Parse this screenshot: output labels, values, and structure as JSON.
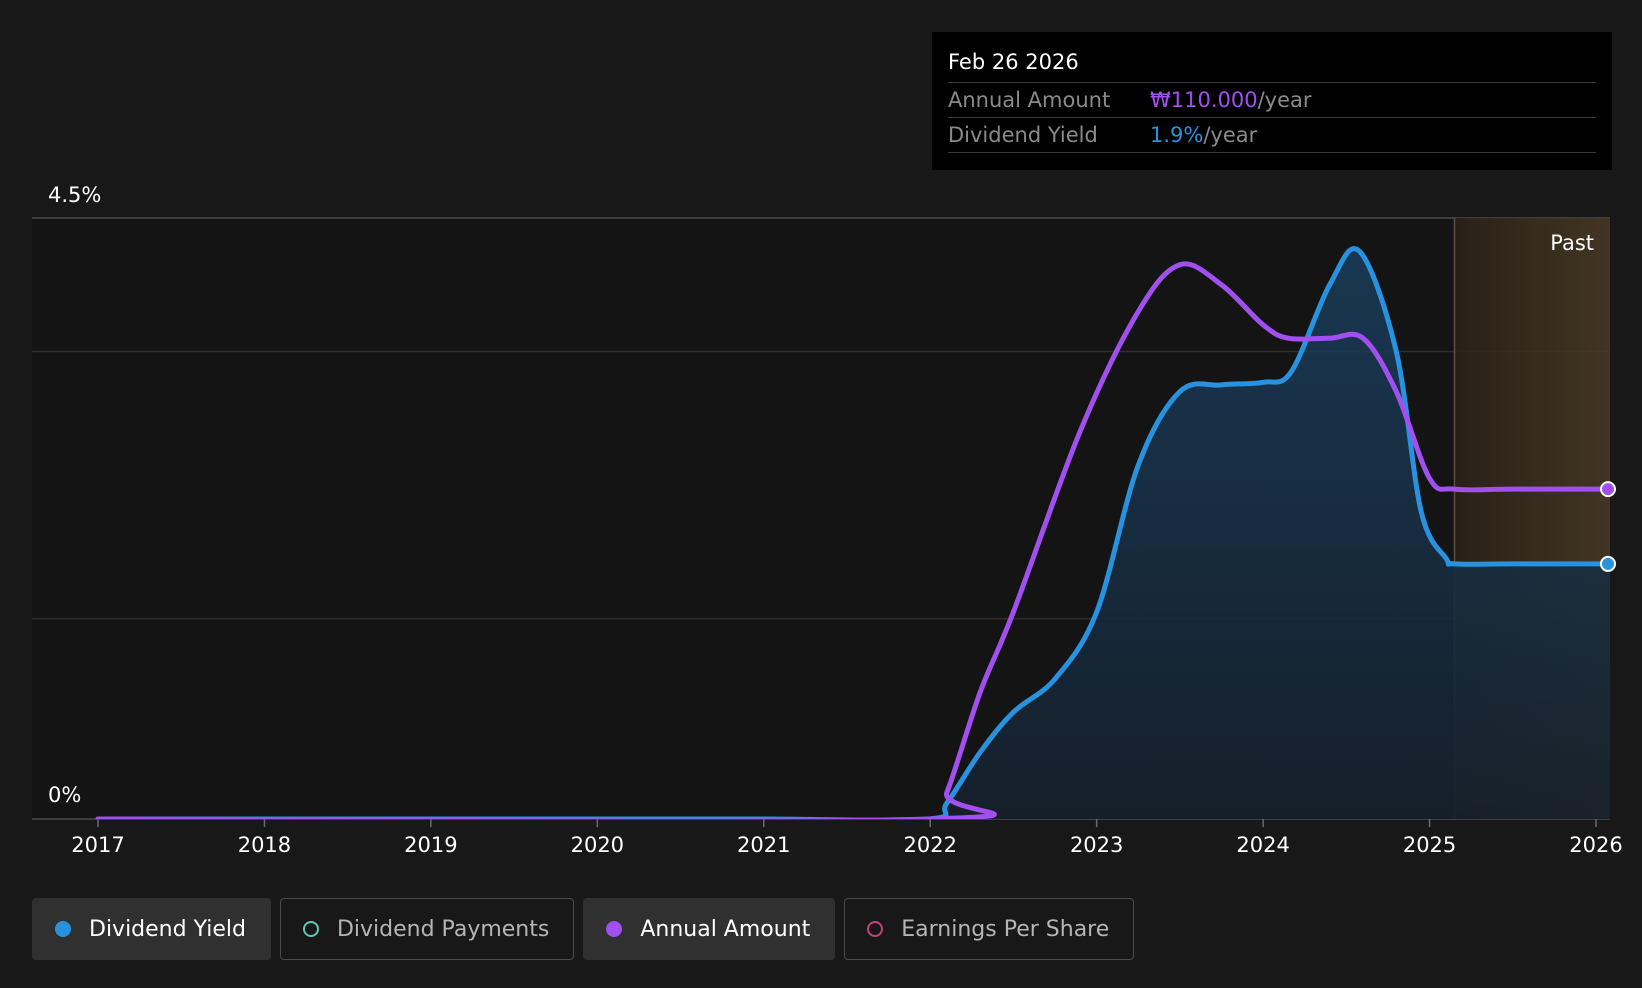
{
  "tooltip": {
    "date": "Feb 26 2026",
    "rows": [
      {
        "label": "Annual Amount",
        "value": "₩110.000",
        "unit": "/year",
        "color": "#a24ff0"
      },
      {
        "label": "Dividend Yield",
        "value": "1.9%",
        "unit": "/year",
        "color": "#2793e0"
      }
    ]
  },
  "legend": [
    {
      "label": "Dividend Yield",
      "color": "#2793e0",
      "active": true,
      "filled": true
    },
    {
      "label": "Dividend Payments",
      "color": "#5ec8b8",
      "active": false,
      "filled": false
    },
    {
      "label": "Annual Amount",
      "color": "#a24ff0",
      "active": true,
      "filled": true
    },
    {
      "label": "Earnings Per Share",
      "color": "#c2417e",
      "active": false,
      "filled": false
    }
  ],
  "chart_data": {
    "type": "line",
    "y_top_label": "4.5%",
    "y_bottom_label": "0%",
    "ylim": [
      0,
      4.5
    ],
    "xlim": [
      2017,
      2026.15
    ],
    "x_ticks": [
      "2017",
      "2018",
      "2019",
      "2020",
      "2021",
      "2022",
      "2023",
      "2024",
      "2025",
      "2026"
    ],
    "past_label": "Past",
    "past_start": 2025.15,
    "series": [
      {
        "name": "Dividend Yield",
        "color": "#2793e0",
        "area": true,
        "points": [
          [
            2017.0,
            0
          ],
          [
            2018.0,
            0
          ],
          [
            2019.0,
            0
          ],
          [
            2020.0,
            0
          ],
          [
            2021.0,
            0
          ],
          [
            2021.99,
            0
          ],
          [
            2022.1,
            0.12
          ],
          [
            2022.3,
            0.5
          ],
          [
            2022.5,
            0.8
          ],
          [
            2022.75,
            1.05
          ],
          [
            2023.0,
            1.55
          ],
          [
            2023.25,
            2.65
          ],
          [
            2023.5,
            3.2
          ],
          [
            2023.75,
            3.25
          ],
          [
            2024.0,
            3.27
          ],
          [
            2024.17,
            3.35
          ],
          [
            2024.4,
            4.0
          ],
          [
            2024.58,
            4.25
          ],
          [
            2024.8,
            3.5
          ],
          [
            2024.95,
            2.3
          ],
          [
            2025.1,
            1.95
          ],
          [
            2025.15,
            1.91
          ],
          [
            2025.5,
            1.91
          ],
          [
            2026.15,
            1.91
          ]
        ]
      },
      {
        "name": "Annual Amount",
        "color": "#a24ff0",
        "area": false,
        "points": [
          [
            2017.0,
            0
          ],
          [
            2021.99,
            0
          ],
          [
            2022.1,
            0.2
          ],
          [
            2022.3,
            0.95
          ],
          [
            2022.5,
            1.55
          ],
          [
            2022.9,
            2.9
          ],
          [
            2023.25,
            3.8
          ],
          [
            2023.5,
            4.15
          ],
          [
            2023.75,
            4.0
          ],
          [
            2024.0,
            3.7
          ],
          [
            2024.15,
            3.6
          ],
          [
            2024.4,
            3.6
          ],
          [
            2024.6,
            3.6
          ],
          [
            2024.8,
            3.2
          ],
          [
            2025.0,
            2.55
          ],
          [
            2025.15,
            2.47
          ],
          [
            2025.5,
            2.47
          ],
          [
            2026.15,
            2.47
          ]
        ]
      }
    ]
  }
}
